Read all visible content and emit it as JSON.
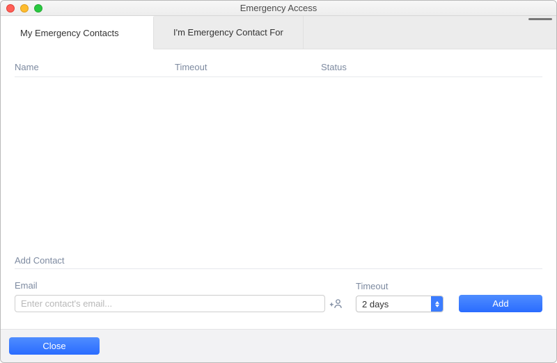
{
  "window": {
    "title": "Emergency Access"
  },
  "tabs": [
    {
      "label": "My Emergency Contacts",
      "active": true
    },
    {
      "label": "I'm Emergency Contact For",
      "active": false
    }
  ],
  "table": {
    "columns": {
      "name": "Name",
      "timeout": "Timeout",
      "status": "Status"
    },
    "rows": []
  },
  "addContact": {
    "section_label": "Add Contact",
    "email_label": "Email",
    "email_placeholder": "Enter contact's email...",
    "email_value": "",
    "timeout_label": "Timeout",
    "timeout_selected": "2 days",
    "add_button_label": "Add"
  },
  "footer": {
    "close_label": "Close"
  }
}
